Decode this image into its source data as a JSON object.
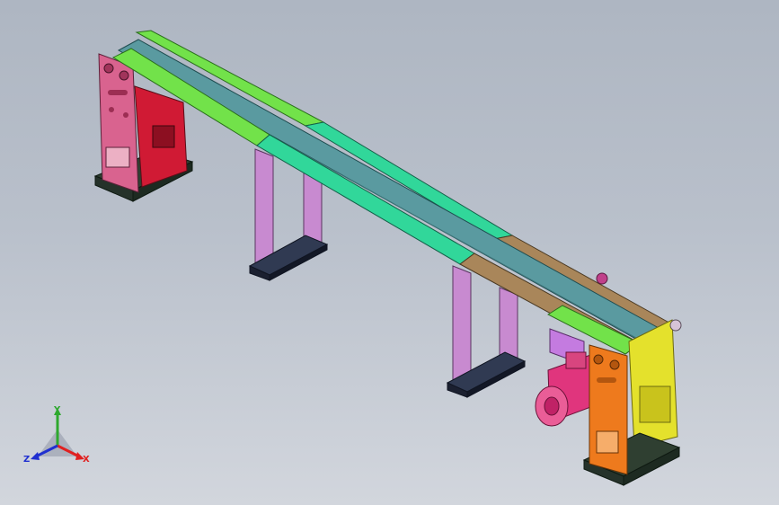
{
  "viewport": {
    "background_top": "#aeb6c2",
    "background_bottom": "#d2d6dd"
  },
  "model": {
    "belt_color": "#5a9aa0",
    "frame_colors": [
      "#72e24a",
      "#31d79a",
      "#a9865a"
    ],
    "left_stand_color": "#d9638f",
    "left_stand_inner_color": "#d01a34",
    "leg_color": "#c88ad0",
    "right_stand_color": "#ee7a1d",
    "right_plate_color": "#e4e12c",
    "motor_color": "#e0357d",
    "base_color": "#3a4a3a"
  },
  "triad": {
    "x_label": "X",
    "y_label": "Y",
    "z_label": "Z",
    "x_color": "#e02020",
    "y_color": "#2ea82e",
    "z_color": "#2030d0"
  }
}
